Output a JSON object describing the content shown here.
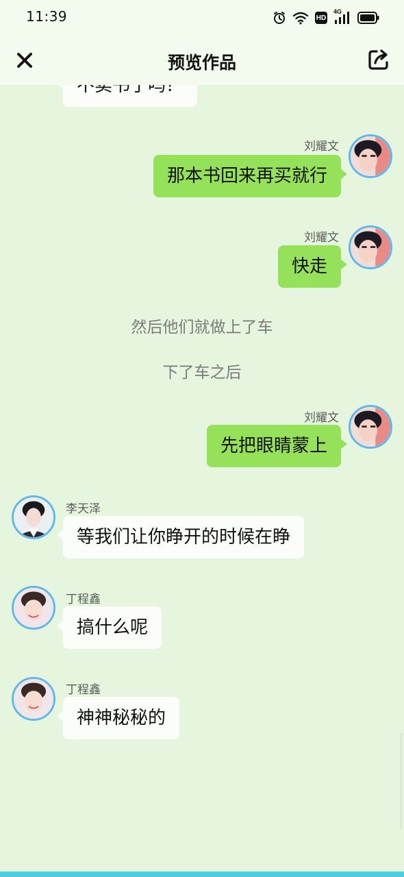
{
  "status_bar": {
    "time": "11:39",
    "icons": [
      "alarm-icon",
      "wifi-icon",
      "hd-icon",
      "signal-4g-icon",
      "battery-icon"
    ],
    "hd_label": "HD",
    "network_label": "4G"
  },
  "header": {
    "title": "预览作品",
    "close_icon": "close-icon",
    "share_icon": "share-icon"
  },
  "messages": [
    {
      "type": "left",
      "sender": "",
      "text": "不卖书了吗？"
    },
    {
      "type": "right",
      "sender": "刘耀文",
      "text": "那本书回来再买就行"
    },
    {
      "type": "right",
      "sender": "刘耀文",
      "text": "快走"
    },
    {
      "type": "narration",
      "text": "然后他们就做上了车"
    },
    {
      "type": "narration",
      "text": "下了车之后"
    },
    {
      "type": "right",
      "sender": "刘耀文",
      "text": "先把眼睛蒙上"
    },
    {
      "type": "left",
      "sender": "李天泽",
      "text": "等我们让你睁开的时候在睁"
    },
    {
      "type": "left",
      "sender": "丁程鑫",
      "text": "搞什么呢"
    },
    {
      "type": "left",
      "sender": "丁程鑫",
      "text": "神神秘秘的"
    }
  ],
  "colors": {
    "background": "#e6f5dd",
    "header_bg": "#f2fbee",
    "right_bubble": "#96e15a",
    "left_bubble": "#fbfef8",
    "avatar_ring": "#5fb8ec",
    "bottom_strip": "#4dd0dd"
  }
}
